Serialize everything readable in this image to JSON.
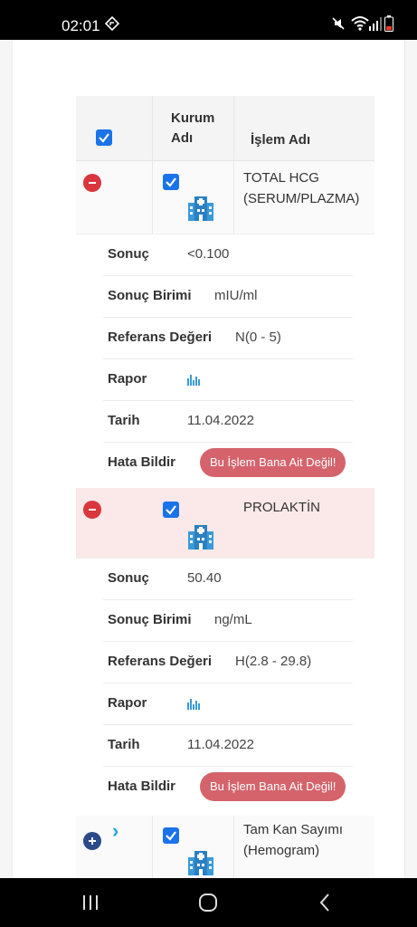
{
  "status_bar": {
    "time": "02:01"
  },
  "table": {
    "header": {
      "kurum_label": "Kurum\nAdı",
      "islem_label": "İşlem Adı"
    },
    "rows": [
      {
        "islem": "TOTAL HCG (SERUM/PLAZMA)",
        "details": {
          "sonuc_label": "Sonuç",
          "sonuc_value": "<0.100",
          "birim_label": "Sonuç Birimi",
          "birim_value": "mIU/ml",
          "referans_label": "Referans Değeri",
          "referans_value": "N(0 - 5)",
          "rapor_label": "Rapor",
          "tarih_label": "Tarih",
          "tarih_value": "11.04.2022",
          "hata_label": "Hata Bildir",
          "hata_button": "Bu İşlem Bana Ait Değil!"
        }
      },
      {
        "islem": "PROLAKTİN",
        "details": {
          "sonuc_label": "Sonuç",
          "sonuc_value": "50.40",
          "birim_label": "Sonuç Birimi",
          "birim_value": "ng/mL",
          "referans_label": "Referans Değeri",
          "referans_value": "H(2.8 - 29.8)",
          "rapor_label": "Rapor",
          "tarih_label": "Tarih",
          "tarih_value": "11.04.2022",
          "hata_label": "Hata Bildir",
          "hata_button": "Bu İşlem Bana Ait Değil!"
        }
      },
      {
        "islem": "Tam Kan Sayımı (Hemogram)"
      }
    ]
  },
  "colors": {
    "accent": "#1a73e8",
    "danger": "#d9363e",
    "error_button": "#d4636c",
    "highlight_row": "#fbe8e8",
    "icon_blue": "#3a9ad9"
  }
}
